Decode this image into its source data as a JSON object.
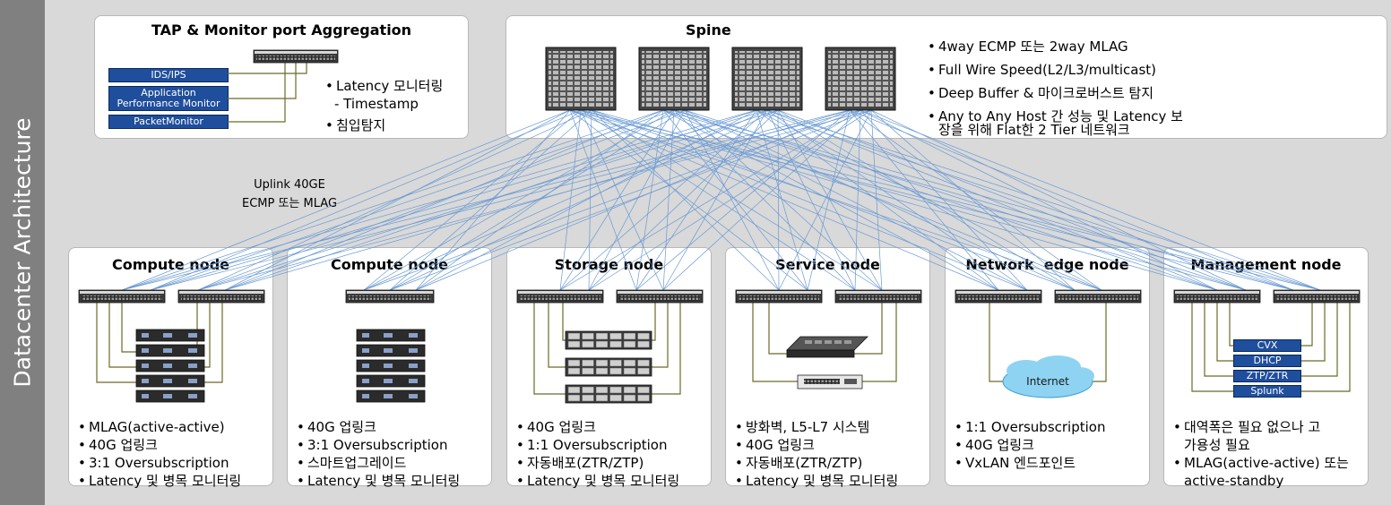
{
  "sidebar_title": "Datacenter Architecture",
  "tap": {
    "title": "TAP & Monitor port Aggregation",
    "tools": [
      "IDS/IPS",
      "Application Performance Monitor",
      "PacketMonitor"
    ],
    "bullets": [
      "Latency 모니터링",
      "- Timestamp",
      "침입탐지"
    ]
  },
  "spine": {
    "title": "Spine",
    "bullets": [
      "4way ECMP 또는 2way MLAG",
      "Full Wire Speed(L2/L3/multicast)",
      "Deep Buffer & 마이크로버스트 탐지",
      "Any to Any Host 간 성능 및 Latency 보",
      "장을 위해 Flat한 2 Tier 네트워크"
    ]
  },
  "uplink": {
    "line1": "Uplink 40GE",
    "line2": "ECMP 또는 MLAG"
  },
  "nodes": [
    {
      "title": "Compute node",
      "bullets": [
        "MLAG(active-active)",
        "40G 업링크",
        "3:1 Oversubscription",
        "Latency 및 병목 모니터링"
      ]
    },
    {
      "title": "Compute node",
      "bullets": [
        "40G 업링크",
        "3:1 Oversubscription",
        "스마트업그레이드",
        "Latency 및 병목 모니터링"
      ]
    },
    {
      "title": "Storage node",
      "bullets": [
        "40G 업링크",
        "1:1 Oversubscription",
        "자동배포(ZTR/ZTP)",
        "Latency 및 병목 모니터링"
      ]
    },
    {
      "title": "Service node",
      "bullets": [
        "방화벽, L5-L7 시스템",
        "40G 업링크",
        "자동배포(ZTR/ZTP)",
        "Latency 및 병목 모니터링"
      ]
    },
    {
      "title": "Network  edge node",
      "bullets": [
        "1:1 Oversubscription",
        "40G 업링크",
        "VxLAN 엔드포인트"
      ]
    },
    {
      "title": "Management node",
      "bullets": [
        "대역폭은 필요 없으나 고",
        "가용성 필요",
        "MLAG(active-active) 또는",
        "active-standby"
      ]
    }
  ],
  "internet_label": "Internet",
  "mgmt_services": [
    "CVX",
    "DHCP",
    "ZTP/ZTR",
    "Splunk"
  ],
  "colors": {
    "link": "#6a9ad4",
    "cable": "#6b6b2a",
    "tool_blue": "#1f4e9c",
    "sidebar": "#808080"
  }
}
